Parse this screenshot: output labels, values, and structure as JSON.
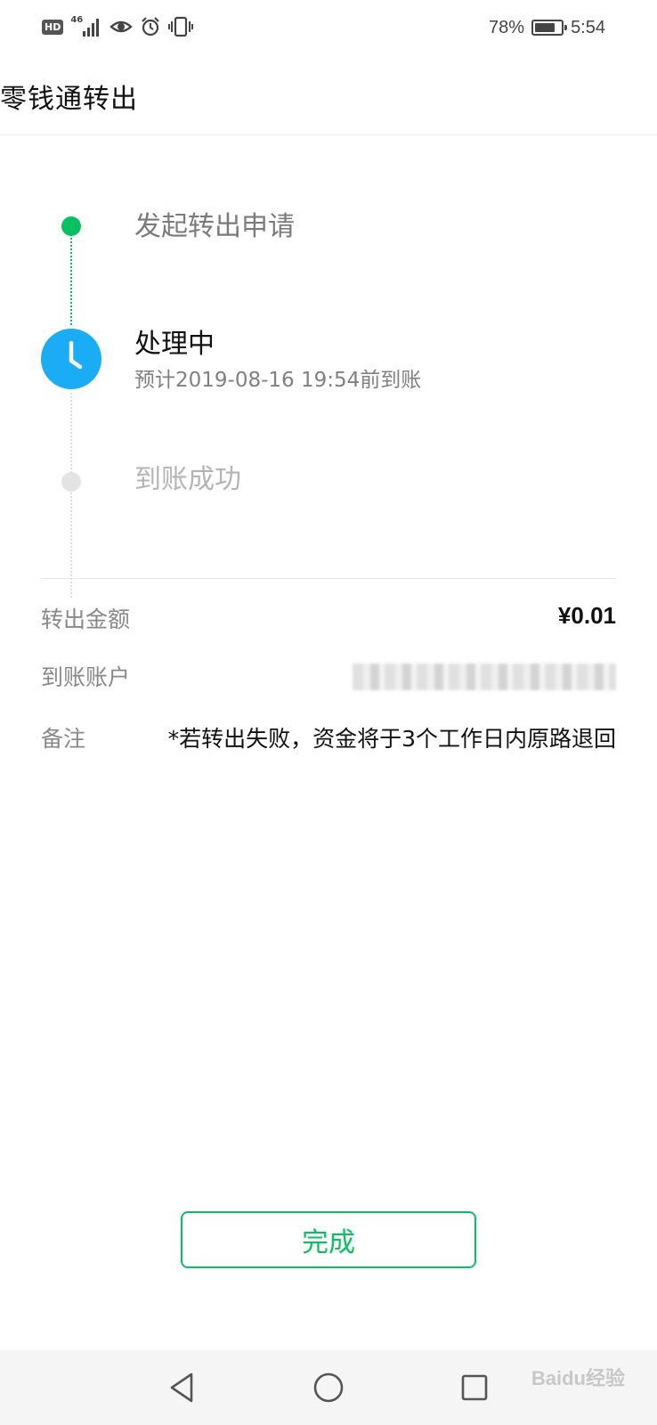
{
  "status_bar": {
    "hd": "HD",
    "network": "46",
    "battery_percent": "78%",
    "battery_level": 0.78,
    "time": "5:54",
    "icons": [
      "hd-icon",
      "signal-icon",
      "eye-icon",
      "alarm-icon",
      "vibrate-icon",
      "battery-icon"
    ]
  },
  "header": {
    "title": "零钱通转出"
  },
  "timeline": {
    "steps": [
      {
        "title": "发起转出申请",
        "state": "done"
      },
      {
        "title": "处理中",
        "subtitle": "预计2019-08-16 19:54前到账",
        "state": "current"
      },
      {
        "title": "到账成功",
        "state": "pending"
      }
    ],
    "colors": {
      "done": "#07c160",
      "current": "#1aadf5",
      "pending": "#e3e3e3"
    }
  },
  "details": {
    "amount": {
      "label": "转出金额",
      "value": "¥0.01"
    },
    "account": {
      "label": "到账账户"
    },
    "note": {
      "label": "备注",
      "value": "*若转出失败，资金将于3个工作日内原路退回"
    }
  },
  "done_button": {
    "label": "完成",
    "color": "#07c160"
  },
  "nav_bar": {
    "icons": [
      "back-icon",
      "home-icon",
      "recent-apps-icon"
    ]
  },
  "watermark": {
    "text": "Baidu经验"
  }
}
